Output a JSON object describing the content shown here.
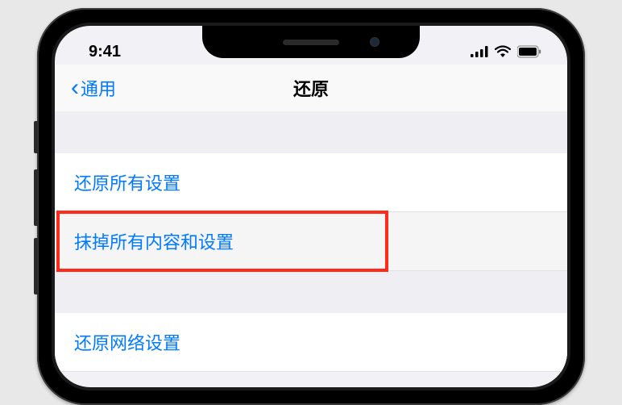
{
  "statusBar": {
    "time": "9:41"
  },
  "navBar": {
    "backLabel": "通用",
    "title": "还原"
  },
  "items": {
    "resetAll": "还原所有设置",
    "eraseAll": "抹掉所有内容和设置",
    "resetNetwork": "还原网络设置"
  }
}
